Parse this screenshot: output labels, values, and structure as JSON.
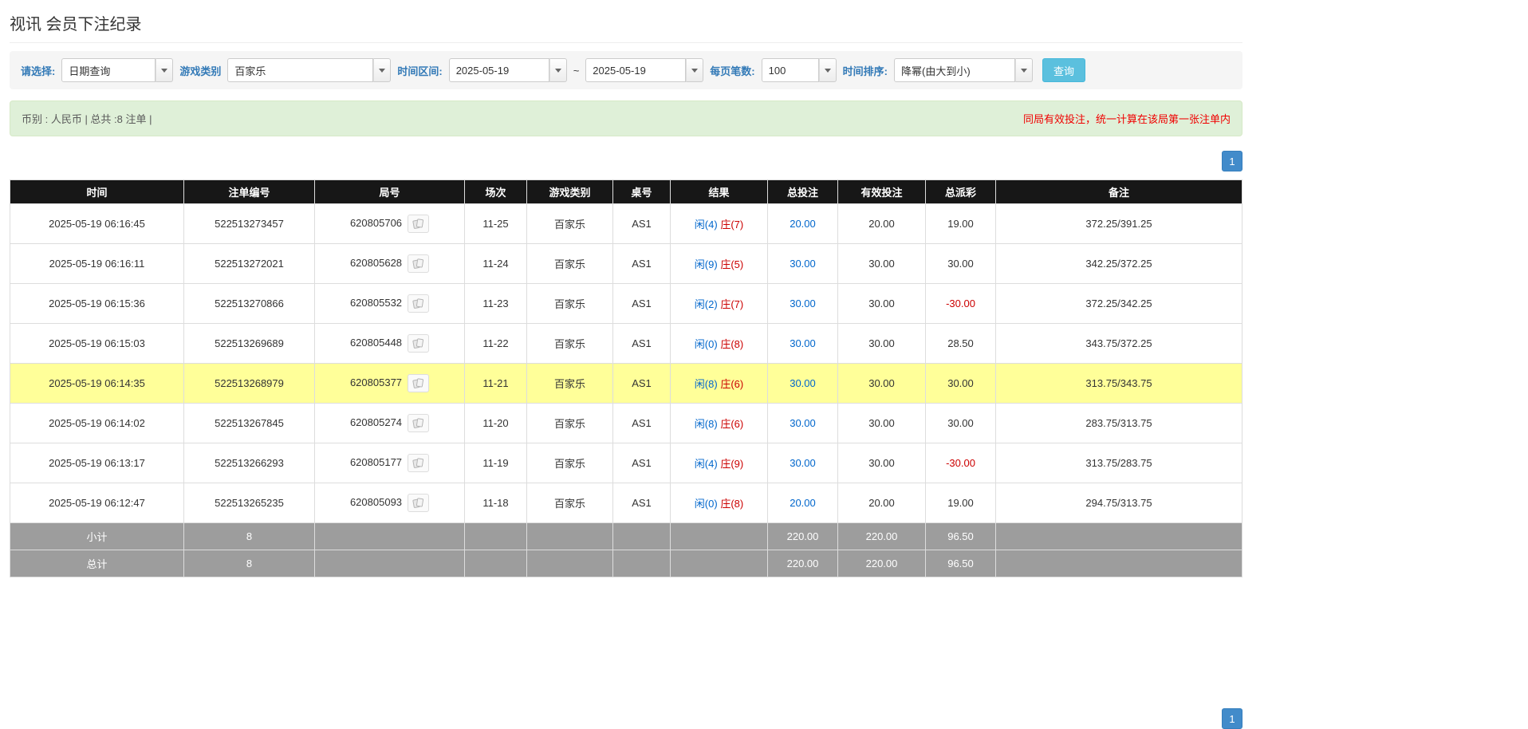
{
  "page": {
    "title": "视讯 会员下注纪录"
  },
  "filters": {
    "select_label": "请选择:",
    "select_value": "日期查询",
    "game_type_label": "游戏类别",
    "game_type_value": "百家乐",
    "time_range_label": "时间区间:",
    "date_from": "2025-05-19",
    "date_separator": "~",
    "date_to": "2025-05-19",
    "per_page_label": "每页笔数:",
    "per_page_value": "100",
    "sort_label": "时间排序:",
    "sort_value": "降幂(由大到小)",
    "search_button_label": "查询"
  },
  "info_bar": {
    "summary": "币别 : 人民币 | 总共 :8 注单 |",
    "notice": "同局有效投注，统一计算在该局第一张注单内"
  },
  "pagination": {
    "current_page": "1"
  },
  "table": {
    "headers": [
      "时间",
      "注单编号",
      "局号",
      "场次",
      "游戏类别",
      "桌号",
      "结果",
      "总投注",
      "有效投注",
      "总派彩",
      "备注"
    ],
    "rows": [
      {
        "time": "2025-05-19 06:16:45",
        "bet_id": "522513273457",
        "round": "620805706",
        "session": "11-25",
        "game": "百家乐",
        "table_no": "AS1",
        "result_player": "闲(4)",
        "result_banker": "庄(7)",
        "total_bet": "20.00",
        "valid_bet": "20.00",
        "payout": "19.00",
        "remark": "372.25/391.25",
        "highlight": false
      },
      {
        "time": "2025-05-19 06:16:11",
        "bet_id": "522513272021",
        "round": "620805628",
        "session": "11-24",
        "game": "百家乐",
        "table_no": "AS1",
        "result_player": "闲(9)",
        "result_banker": "庄(5)",
        "total_bet": "30.00",
        "valid_bet": "30.00",
        "payout": "30.00",
        "remark": "342.25/372.25",
        "highlight": false
      },
      {
        "time": "2025-05-19 06:15:36",
        "bet_id": "522513270866",
        "round": "620805532",
        "session": "11-23",
        "game": "百家乐",
        "table_no": "AS1",
        "result_player": "闲(2)",
        "result_banker": "庄(7)",
        "total_bet": "30.00",
        "valid_bet": "30.00",
        "payout": "-30.00",
        "remark": "372.25/342.25",
        "highlight": false
      },
      {
        "time": "2025-05-19 06:15:03",
        "bet_id": "522513269689",
        "round": "620805448",
        "session": "11-22",
        "game": "百家乐",
        "table_no": "AS1",
        "result_player": "闲(0)",
        "result_banker": "庄(8)",
        "total_bet": "30.00",
        "valid_bet": "30.00",
        "payout": "28.50",
        "remark": "343.75/372.25",
        "highlight": false
      },
      {
        "time": "2025-05-19 06:14:35",
        "bet_id": "522513268979",
        "round": "620805377",
        "session": "11-21",
        "game": "百家乐",
        "table_no": "AS1",
        "result_player": "闲(8)",
        "result_banker": "庄(6)",
        "total_bet": "30.00",
        "valid_bet": "30.00",
        "payout": "30.00",
        "remark": "313.75/343.75",
        "highlight": true
      },
      {
        "time": "2025-05-19 06:14:02",
        "bet_id": "522513267845",
        "round": "620805274",
        "session": "11-20",
        "game": "百家乐",
        "table_no": "AS1",
        "result_player": "闲(8)",
        "result_banker": "庄(6)",
        "total_bet": "30.00",
        "valid_bet": "30.00",
        "payout": "30.00",
        "remark": "283.75/313.75",
        "highlight": false
      },
      {
        "time": "2025-05-19 06:13:17",
        "bet_id": "522513266293",
        "round": "620805177",
        "session": "11-19",
        "game": "百家乐",
        "table_no": "AS1",
        "result_player": "闲(4)",
        "result_banker": "庄(9)",
        "total_bet": "30.00",
        "valid_bet": "30.00",
        "payout": "-30.00",
        "remark": "313.75/283.75",
        "highlight": false
      },
      {
        "time": "2025-05-19 06:12:47",
        "bet_id": "522513265235",
        "round": "620805093",
        "session": "11-18",
        "game": "百家乐",
        "table_no": "AS1",
        "result_player": "闲(0)",
        "result_banker": "庄(8)",
        "total_bet": "20.00",
        "valid_bet": "20.00",
        "payout": "19.00",
        "remark": "294.75/313.75",
        "highlight": false
      }
    ],
    "subtotal": {
      "label": "小计",
      "count": "8",
      "total_bet": "220.00",
      "valid_bet": "220.00",
      "payout": "96.50"
    },
    "grand_total": {
      "label": "总计",
      "count": "8",
      "total_bet": "220.00",
      "valid_bet": "220.00",
      "payout": "96.50"
    }
  },
  "colors": {
    "player_blue": "#0066cc",
    "banker_red": "#cc0000",
    "negative_red": "#cc0000",
    "link_blue": "#0066cc",
    "pagination_blue": "#428bca",
    "query_button_blue": "#5bc0de",
    "highlight_yellow": "#ffff99",
    "header_black": "#171717",
    "footer_gray": "#9d9d9d",
    "info_green": "#dff0d8"
  },
  "icons": {
    "dropdown": "chevron-down",
    "round_detail": "playing-cards"
  }
}
